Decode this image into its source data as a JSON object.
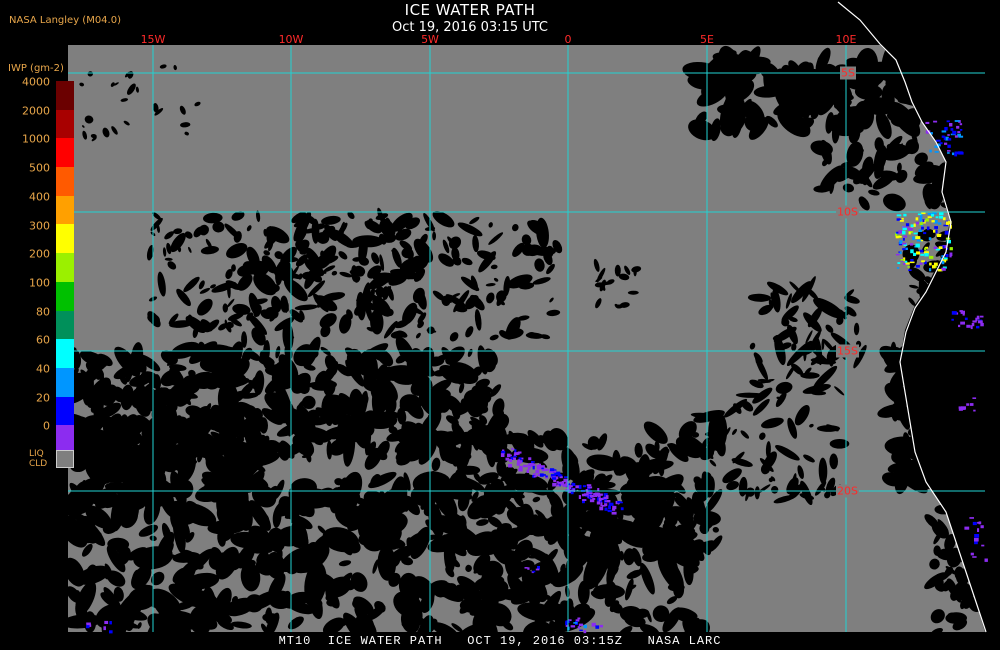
{
  "header": {
    "credit": "NASA Langley (M04.0)",
    "title": "ICE WATER PATH",
    "subtitle": "Oct 19, 2016 03:15 UTC"
  },
  "map": {
    "longitude_labels": [
      "15W",
      "10W",
      "5W",
      "0",
      "5E",
      "10E"
    ],
    "latitude_labels": [
      "5S",
      "10S",
      "15S",
      "20S"
    ],
    "colors": {
      "background": "#7f7f7f",
      "grid": "#22d3d3",
      "coast": "#ffffff",
      "label": "#ff2a2a"
    }
  },
  "legend": {
    "title": "IWP (gm-2)",
    "ticks": [
      "4000",
      "2000",
      "1000",
      "500",
      "400",
      "300",
      "200",
      "100",
      "80",
      "60",
      "40",
      "20",
      "0"
    ],
    "colors": [
      "#6b0000",
      "#a80000",
      "#ff0000",
      "#ff5a00",
      "#ffa000",
      "#ffff00",
      "#9bf000",
      "#00c000",
      "#00905a",
      "#00ffff",
      "#0096ff",
      "#0000ff",
      "#8c2cf0"
    ],
    "liquid_label_1": "LIQ",
    "liquid_label_2": "CLD",
    "liquid_color": "#7f7f7f"
  },
  "footer": {
    "text": "MT10  ICE WATER PATH   OCT 19, 2016 03:15Z   NASA LARC"
  }
}
